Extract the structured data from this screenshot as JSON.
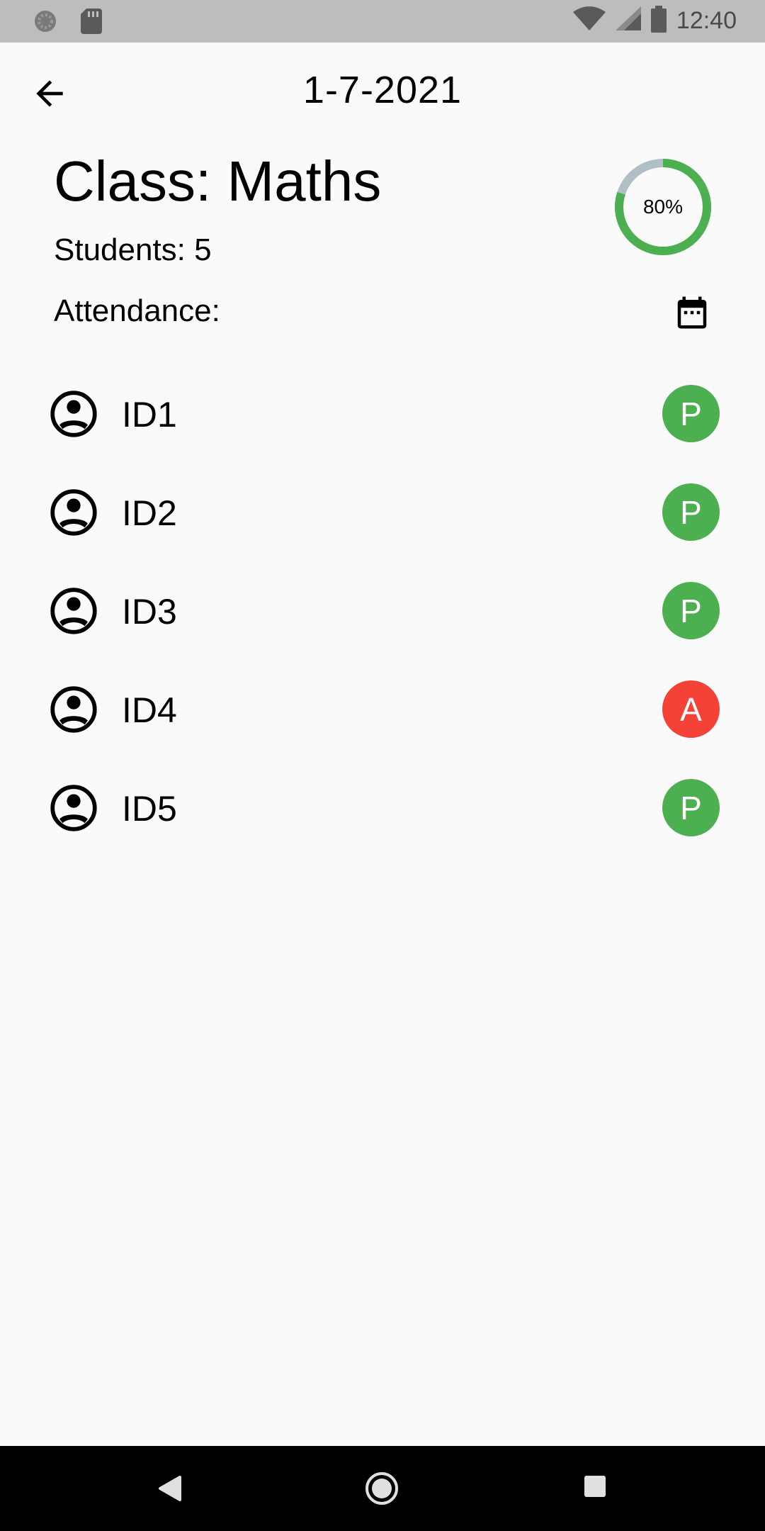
{
  "status_bar": {
    "time": "12:40",
    "icons": [
      "settings-icon",
      "sd-card-icon",
      "wifi-icon",
      "signal-icon",
      "battery-icon"
    ]
  },
  "app_bar": {
    "title": "1-7-2021",
    "back_icon": "arrow-back-icon"
  },
  "class_info": {
    "title": "Class: Maths",
    "students": "Students: 5",
    "attendance_label": "Attendance:",
    "attendance_percent_text": "80%",
    "attendance_fraction": 0.8,
    "calendar_icon": "calendar-icon"
  },
  "students": [
    {
      "id": "ID1",
      "status": "P"
    },
    {
      "id": "ID2",
      "status": "P"
    },
    {
      "id": "ID3",
      "status": "P"
    },
    {
      "id": "ID4",
      "status": "A"
    },
    {
      "id": "ID5",
      "status": "P"
    }
  ],
  "colors": {
    "present": "#4caf50",
    "absent": "#f44336",
    "ring_track": "#b0bec5",
    "ring_fill": "#4caf50"
  },
  "nav_bar": {
    "icons": [
      "back-triangle-icon",
      "home-circle-icon",
      "recents-square-icon"
    ]
  }
}
